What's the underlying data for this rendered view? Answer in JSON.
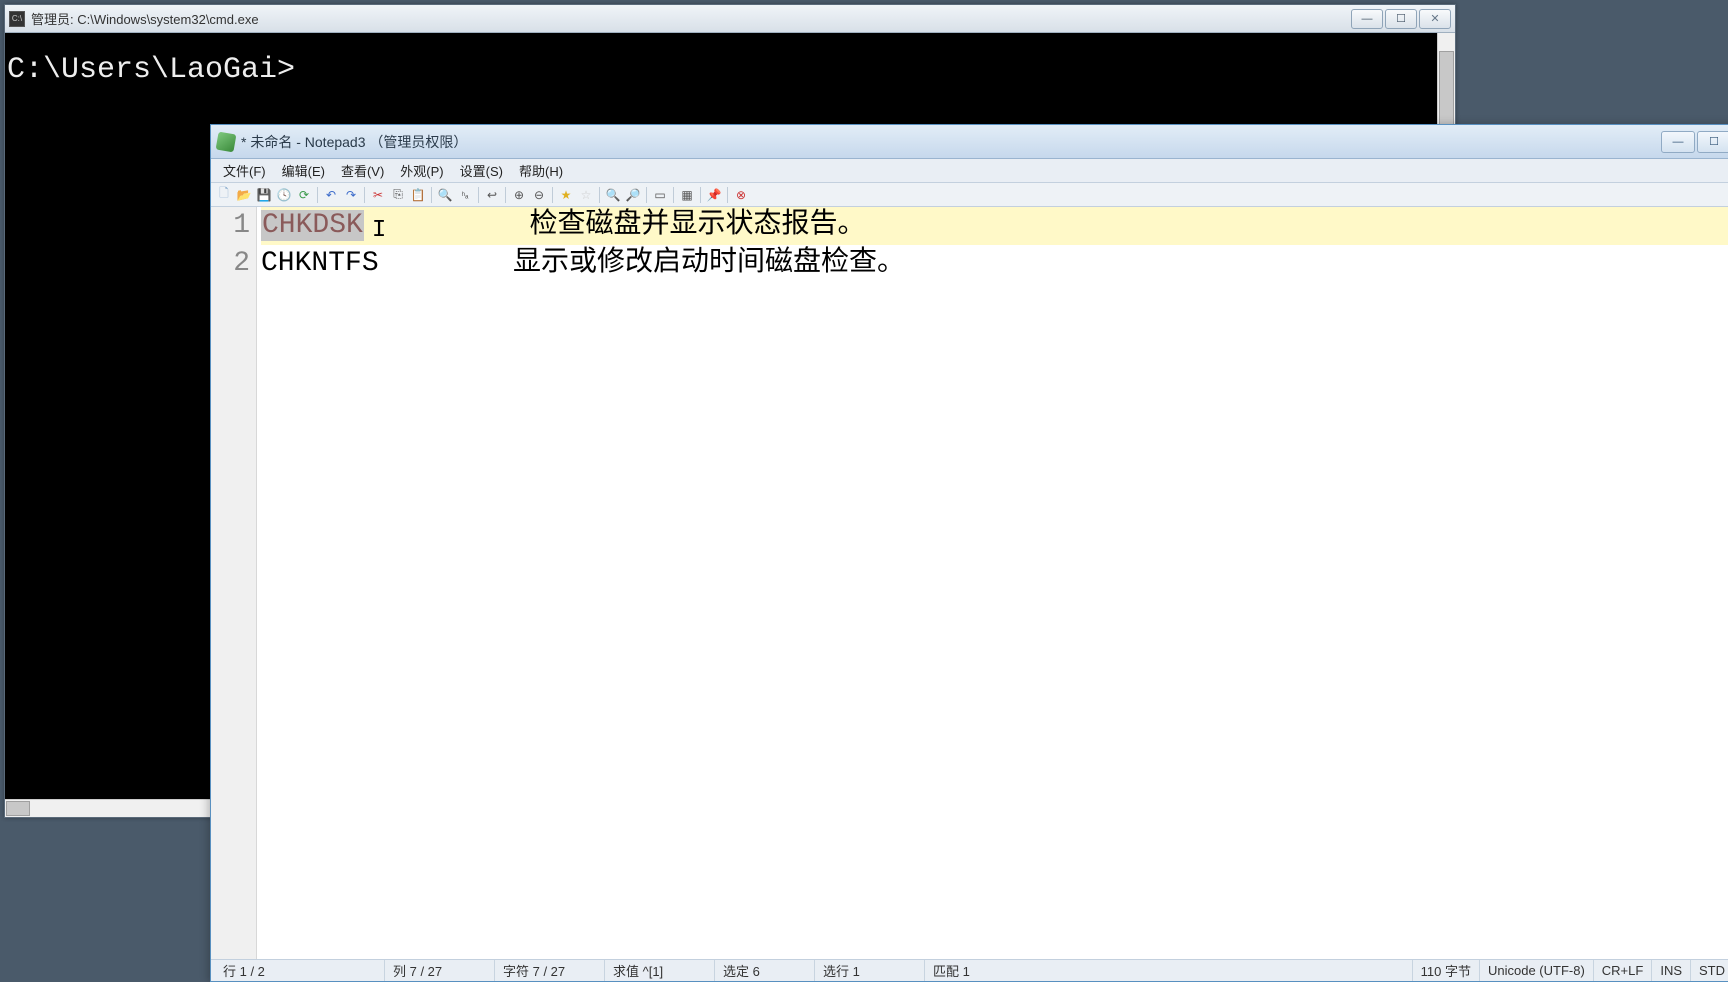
{
  "cmd": {
    "title": "管理员: C:\\Windows\\system32\\cmd.exe",
    "prompt": "C:\\Users\\LaoGai>"
  },
  "notepad": {
    "title": "* 未命名 - Notepad3 （管理员权限）",
    "menu": {
      "file": "文件(F)",
      "edit": "编辑(E)",
      "view": "查看(V)",
      "appearance": "外观(P)",
      "settings": "设置(S)",
      "help": "帮助(H)"
    },
    "lines": {
      "n1": "1",
      "n2": "2",
      "l1_cmd": "CHKDSK",
      "l1_desc": "检查磁盘并显示状态报告。",
      "l2_cmd": "CHKNTFS",
      "l2_desc": "显示或修改启动时间磁盘检查。"
    },
    "status": {
      "line": "行  1 / 2",
      "col": "列  7 / 27",
      "char": "字符  7 / 27",
      "eval": "求值  ^[1]",
      "sel": "选定  6",
      "selline": "选行  1",
      "match": "匹配  1",
      "bytes": "110 字节",
      "enc": "Unicode (UTF-8)",
      "eol": "CR+LF",
      "ins": "INS",
      "std": "STD"
    }
  }
}
